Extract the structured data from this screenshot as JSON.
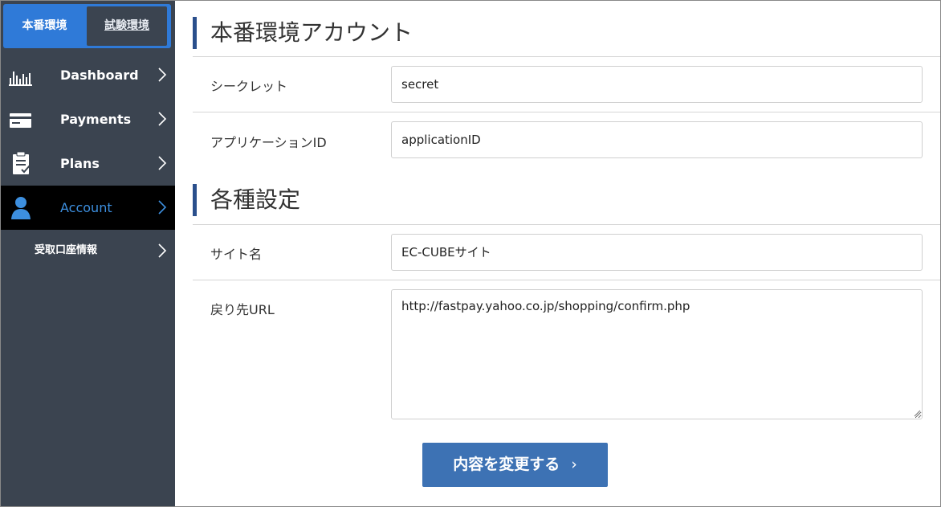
{
  "sidebar": {
    "env_tabs": {
      "production": "本番環境",
      "test": "試験環境"
    },
    "items": [
      {
        "label": "Dashboard",
        "icon": "bar-chart-icon"
      },
      {
        "label": "Payments",
        "icon": "credit-card-icon"
      },
      {
        "label": "Plans",
        "icon": "clipboard-icon"
      },
      {
        "label": "Account",
        "icon": "user-icon"
      }
    ],
    "subitem": {
      "label": "受取口座情報"
    }
  },
  "main": {
    "section1_title": "本番環境アカウント",
    "secret_label": "シークレット",
    "secret_value": "secret",
    "appid_label": "アプリケーションID",
    "appid_value": "applicationID",
    "section2_title": "各種設定",
    "sitename_label": "サイト名",
    "sitename_value": "EC-CUBEサイト",
    "return_url_label": "戻り先URL",
    "return_url_value": "http://fastpay.yahoo.co.jp/shopping/confirm.php",
    "submit_label": "内容を変更する",
    "submit_chevron": "›"
  },
  "colors": {
    "sidebar_bg": "#3b4450",
    "env_switch": "#2f7ad8",
    "active_item_text": "#3d8fdf",
    "section_bar": "#2a4f8c",
    "button": "#3d72b4"
  }
}
